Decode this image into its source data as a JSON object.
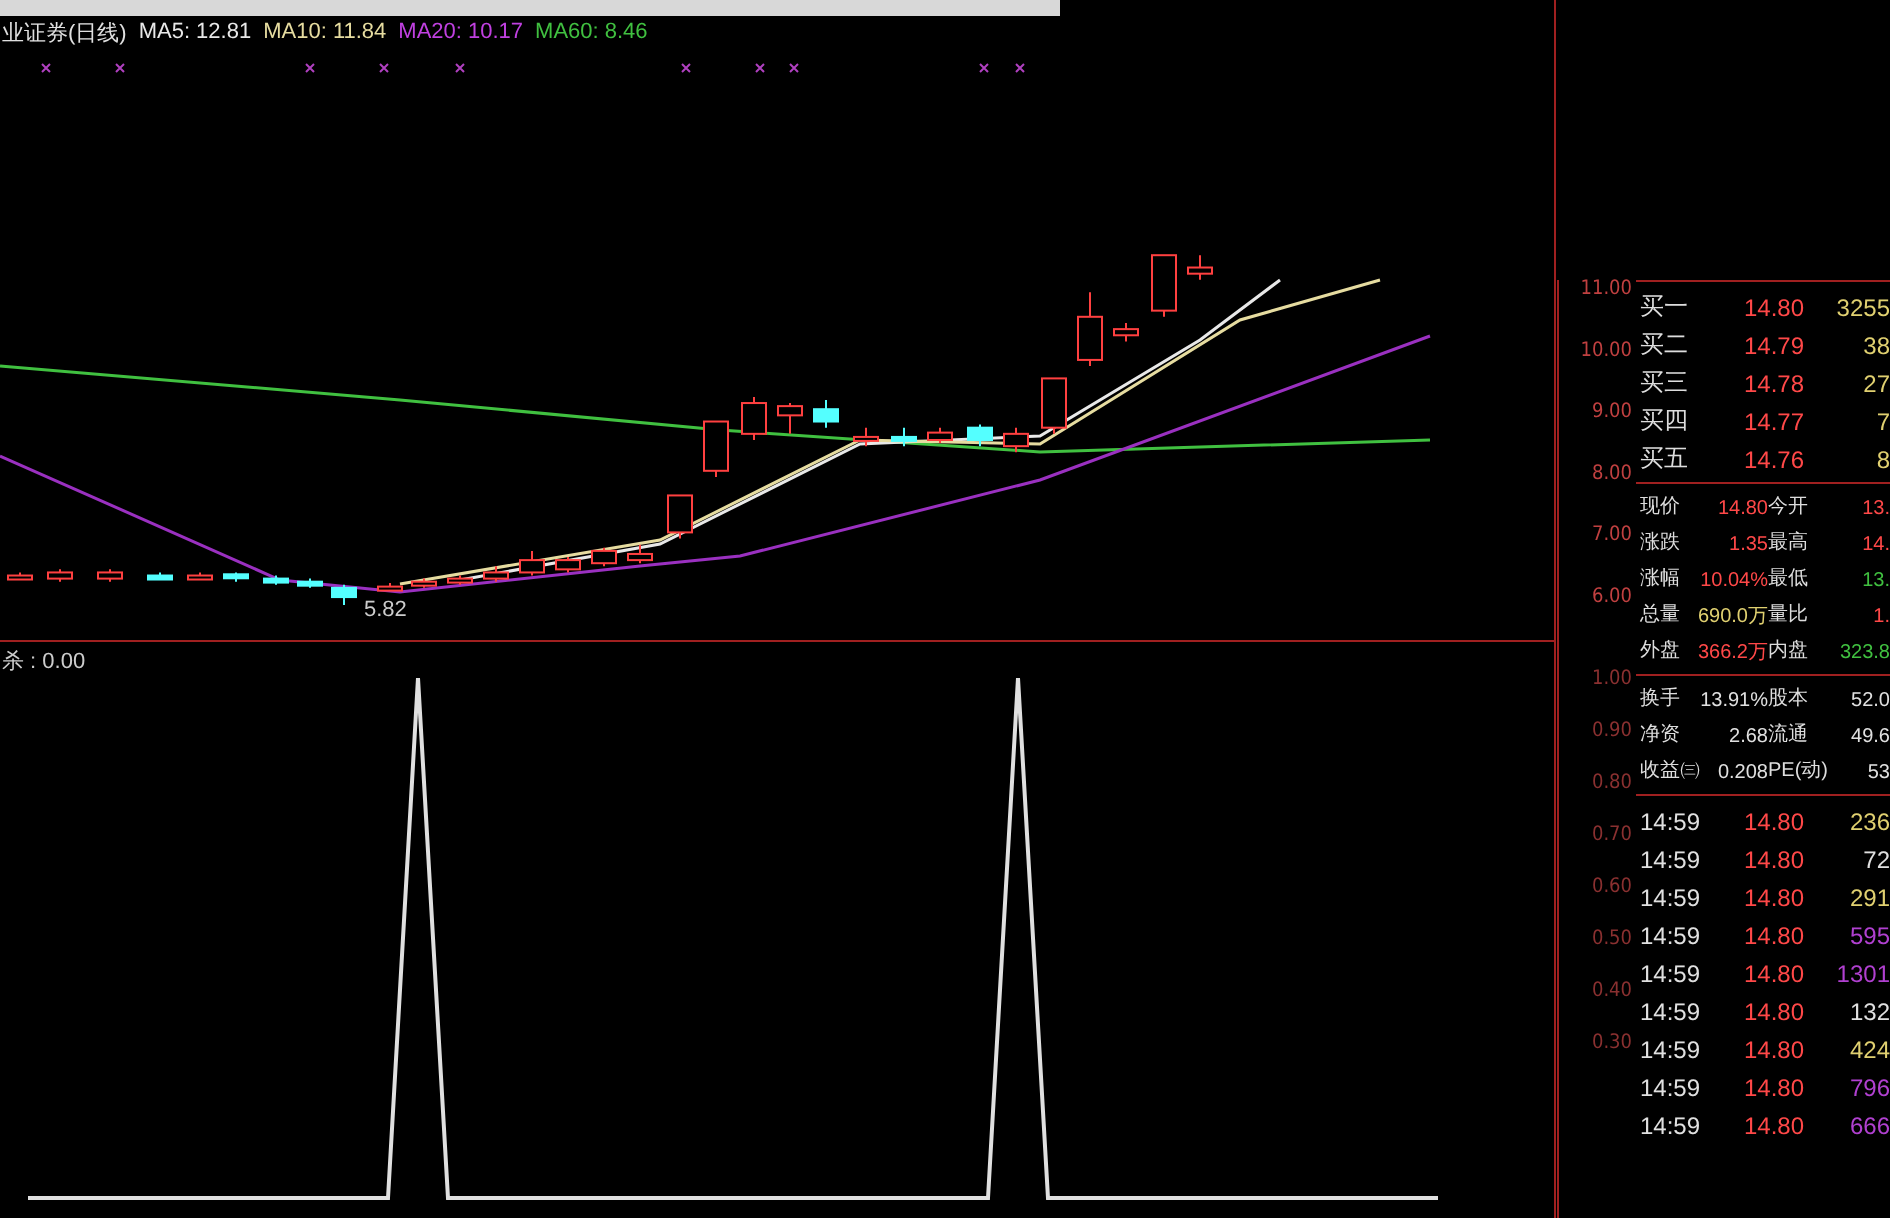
{
  "chart_title": "业证券(日线)",
  "legend": [
    {
      "label": "MA5: 12.81",
      "color": "#e8e8e8"
    },
    {
      "label": "MA10: 11.84",
      "color": "#e6dca0"
    },
    {
      "label": "MA20: 10.17",
      "color": "#c040e0"
    },
    {
      "label": "MA60: 8.46",
      "color": "#40c040"
    }
  ],
  "price_axis": [
    "11.00",
    "10.00",
    "9.00",
    "8.00",
    "7.00",
    "6.00"
  ],
  "low_label": "5.82",
  "indicator": {
    "label": "杀 : 0.00",
    "axis": [
      "1.00",
      "0.90",
      "0.80",
      "0.70",
      "0.60",
      "0.50",
      "0.40",
      "0.30"
    ]
  },
  "order_book": [
    {
      "label": "买一",
      "price": "14.80",
      "volume": "3255"
    },
    {
      "label": "买二",
      "price": "14.79",
      "volume": "38"
    },
    {
      "label": "买三",
      "price": "14.78",
      "volume": "27"
    },
    {
      "label": "买四",
      "price": "14.77",
      "volume": "7"
    },
    {
      "label": "买五",
      "price": "14.76",
      "volume": "8"
    }
  ],
  "quote": [
    {
      "label": "现价",
      "value": "14.80",
      "label2": "今开",
      "value2": "13."
    },
    {
      "label": "涨跌",
      "value": "1.35",
      "label2": "最高",
      "value2": "14."
    },
    {
      "label": "涨幅",
      "value": "10.04%",
      "label2": "最低",
      "value2": "13."
    },
    {
      "label": "总量",
      "value": "690.0万",
      "label2": "量比",
      "value2": "1."
    },
    {
      "label": "外盘",
      "value": "366.2万",
      "label2": "内盘",
      "value2": "323.8"
    }
  ],
  "fundamentals": [
    {
      "label": "换手",
      "value": "13.91%",
      "label2": "股本",
      "value2": "52.0"
    },
    {
      "label": "净资",
      "value": "2.68",
      "label2": "流通",
      "value2": "49.6"
    },
    {
      "label": "收益㈢",
      "value": "0.208",
      "label2": "PE(动)",
      "value2": "53"
    }
  ],
  "ticks": [
    {
      "time": "14:59",
      "price": "14.80",
      "volume": "236",
      "color": "#e0d070"
    },
    {
      "time": "14:59",
      "price": "14.80",
      "volume": "72",
      "color": "#e0e0e0"
    },
    {
      "time": "14:59",
      "price": "14.80",
      "volume": "291",
      "color": "#e0d070"
    },
    {
      "time": "14:59",
      "price": "14.80",
      "volume": "595",
      "color": "#b040d0"
    },
    {
      "time": "14:59",
      "price": "14.80",
      "volume": "1301",
      "color": "#b040d0"
    },
    {
      "time": "14:59",
      "price": "14.80",
      "volume": "132",
      "color": "#e0e0e0"
    },
    {
      "time": "14:59",
      "price": "14.80",
      "volume": "424",
      "color": "#e0d070"
    },
    {
      "time": "14:59",
      "price": "14.80",
      "volume": "796",
      "color": "#b040d0"
    },
    {
      "time": "14:59",
      "price": "14.80",
      "volume": "666",
      "color": "#b040d0"
    }
  ]
}
